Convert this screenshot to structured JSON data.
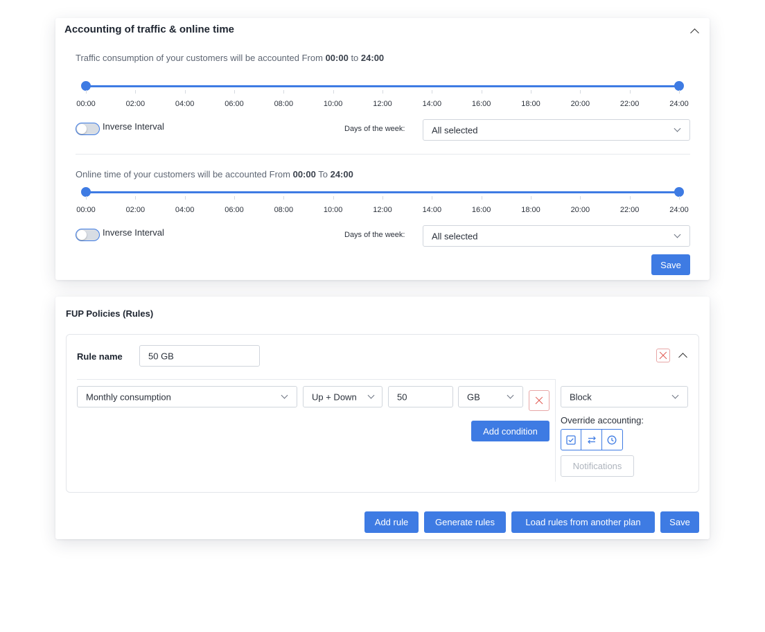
{
  "accounting": {
    "title": "Accounting of traffic & online time",
    "traffic": {
      "desc_prefix": "Traffic consumption of your customers will be accounted From",
      "from": "00:00",
      "connector": "to",
      "to": "24:00",
      "range_start_fraction": 0,
      "range_end_fraction": 1,
      "ticks": [
        "00:00",
        "02:00",
        "04:00",
        "06:00",
        "08:00",
        "10:00",
        "12:00",
        "14:00",
        "16:00",
        "18:00",
        "20:00",
        "22:00",
        "24:00"
      ],
      "inverse_label": "Inverse Interval",
      "inverse_enabled": false,
      "days_label": "Days of the week:",
      "days_value": "All selected"
    },
    "online": {
      "desc_prefix": "Online time of your customers will be accounted From",
      "from": "00:00",
      "connector": "To",
      "to": "24:00",
      "range_start_fraction": 0,
      "range_end_fraction": 1,
      "ticks": [
        "00:00",
        "02:00",
        "04:00",
        "06:00",
        "08:00",
        "10:00",
        "12:00",
        "14:00",
        "16:00",
        "18:00",
        "20:00",
        "22:00",
        "24:00"
      ],
      "inverse_label": "Inverse Interval",
      "inverse_enabled": false,
      "days_label": "Days of the week:",
      "days_value": "All selected"
    },
    "save_label": "Save"
  },
  "fup": {
    "title": "FUP Policies (Rules)",
    "rule": {
      "name_label": "Rule name",
      "name_value": "50 GB",
      "condition": {
        "metric": "Monthly consumption",
        "direction": "Up + Down",
        "amount": "50",
        "unit": "GB"
      },
      "add_condition_label": "Add condition",
      "action": "Block",
      "override_label": "Override accounting:",
      "override_icons": [
        "checkbox-icon",
        "transfer-arrows-icon",
        "clock-icon"
      ],
      "notifications_label": "Notifications"
    },
    "buttons": {
      "add_rule": "Add rule",
      "generate_rules": "Generate rules",
      "load_rules": "Load rules from another plan",
      "save": "Save"
    }
  },
  "colors": {
    "accent": "#3e7be3",
    "danger": "#e0574f"
  }
}
